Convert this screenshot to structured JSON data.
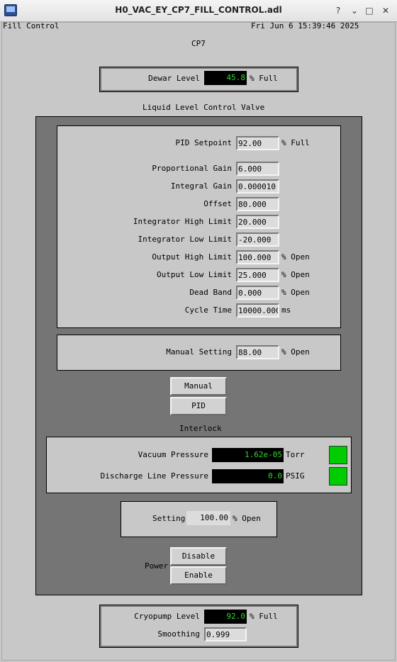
{
  "window": {
    "title": "H0_VAC_EY_CP7_FILL_CONTROL.adl",
    "controls": {
      "help": "?",
      "minimize": "⌄",
      "maximize": "□",
      "close": "✕"
    }
  },
  "header": {
    "screen_name": "Fill Control",
    "timestamp": "Fri Jun  6 15:39:46 2025",
    "device": "CP7"
  },
  "dewar": {
    "label": "Dewar Level",
    "value": "45.8",
    "unit": "% Full"
  },
  "valve_section": {
    "title": "Liquid Level Control Valve"
  },
  "pid": {
    "setpoint": {
      "label": "PID Setpoint",
      "value": "92.00",
      "unit": "% Full"
    },
    "params": [
      {
        "label": "Proportional Gain",
        "value": "6.000",
        "unit": ""
      },
      {
        "label": "Integral Gain",
        "value": "0.000010",
        "unit": ""
      },
      {
        "label": "Offset",
        "value": "80.000",
        "unit": ""
      },
      {
        "label": "Integrator High Limit",
        "value": "20.000",
        "unit": ""
      },
      {
        "label": "Integrator Low Limit",
        "value": "-20.000",
        "unit": ""
      },
      {
        "label": "Output High Limit",
        "value": "100.000",
        "unit": "% Open"
      },
      {
        "label": "Output Low Limit",
        "value": "25.000",
        "unit": "% Open"
      },
      {
        "label": "Dead Band",
        "value": "0.000",
        "unit": "% Open"
      },
      {
        "label": "Cycle Time",
        "value": "10000.0000",
        "unit": "ms"
      }
    ]
  },
  "manual": {
    "label": "Manual Setting",
    "value": "88.00",
    "unit": "% Open"
  },
  "mode_buttons": {
    "manual": "Manual",
    "pid": "PID"
  },
  "interlock": {
    "title": "Interlock",
    "vacuum": {
      "label": "Vacuum Pressure",
      "value": "1.62e-05",
      "unit": "Torr",
      "status_color": "#00cc00"
    },
    "discharge": {
      "label": "Discharge Line Pressure",
      "value": "0.0",
      "unit": "PSIG",
      "status_color": "#00cc00"
    }
  },
  "setting": {
    "label": "Setting",
    "value": "100.00",
    "unit": "% Open"
  },
  "power": {
    "label": "Power",
    "disable": "Disable",
    "enable": "Enable"
  },
  "cryopump": {
    "label": "Cryopump Level",
    "value": "92.0",
    "unit": "% Full",
    "smoothing_label": "Smoothing",
    "smoothing_value": "0.999"
  }
}
